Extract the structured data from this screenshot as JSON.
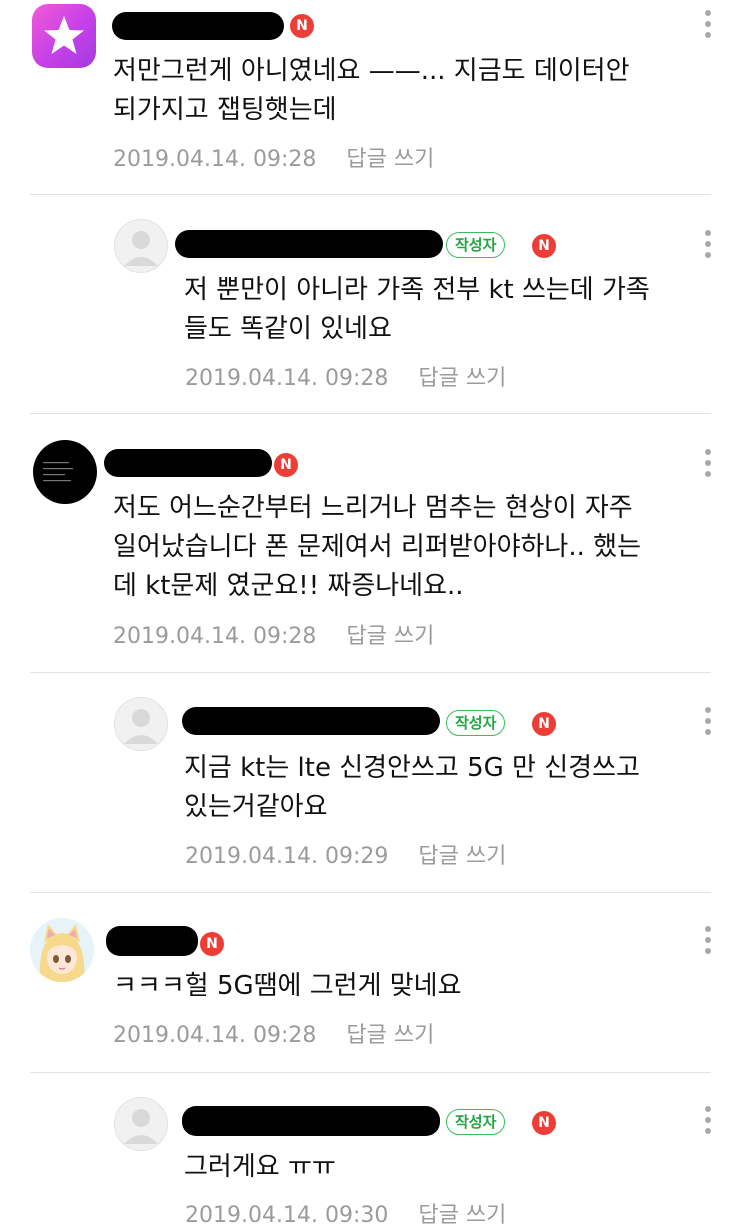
{
  "comments": [
    {
      "text_lines": [
        "저만그런게 아니였네요 ——... 지금도 데이터안",
        "되가지고 잽팅햇는데"
      ],
      "date": "2019.04.14. 09:28",
      "reply_label": "답글 쓰기",
      "badge": "N",
      "avatar": "purple-star-avatar"
    },
    {
      "text_lines": [
        "저 뿐만이 아니라 가족 전부 kt 쓰는데 가족",
        "들도 똑같이 있네요"
      ],
      "date": "2019.04.14. 09:28",
      "reply_label": "답글 쓰기",
      "author_label": "작성자",
      "badge": "N",
      "avatar": "default-avatar"
    },
    {
      "text_lines": [
        "저도 어느순간부터 느리거나 멈추는 현상이 자주",
        "일어났습니다 폰 문제여서 리퍼받아야하나.. 했는",
        "데 kt문제 였군요!! 짜증나네요.."
      ],
      "date": "2019.04.14. 09:28",
      "reply_label": "답글 쓰기",
      "badge": "N",
      "avatar": "black-avatar"
    },
    {
      "text_lines": [
        "지금 kt는 lte 신경안쓰고 5G 만 신경쓰고",
        "있는거같아요"
      ],
      "date": "2019.04.14. 09:29",
      "reply_label": "답글 쓰기",
      "author_label": "작성자",
      "badge": "N",
      "avatar": "default-avatar"
    },
    {
      "text_lines": [
        "ㅋㅋㅋ헐 5G땜에 그런게 맞네요"
      ],
      "date": "2019.04.14. 09:28",
      "reply_label": "답글 쓰기",
      "badge": "N",
      "avatar": "anime-girl-avatar"
    },
    {
      "text_lines": [
        "그러게요 ㅠㅠ"
      ],
      "date": "2019.04.14. 09:30",
      "reply_label": "답글 쓰기",
      "author_label": "작성자",
      "badge": "N",
      "avatar": "default-avatar"
    }
  ]
}
